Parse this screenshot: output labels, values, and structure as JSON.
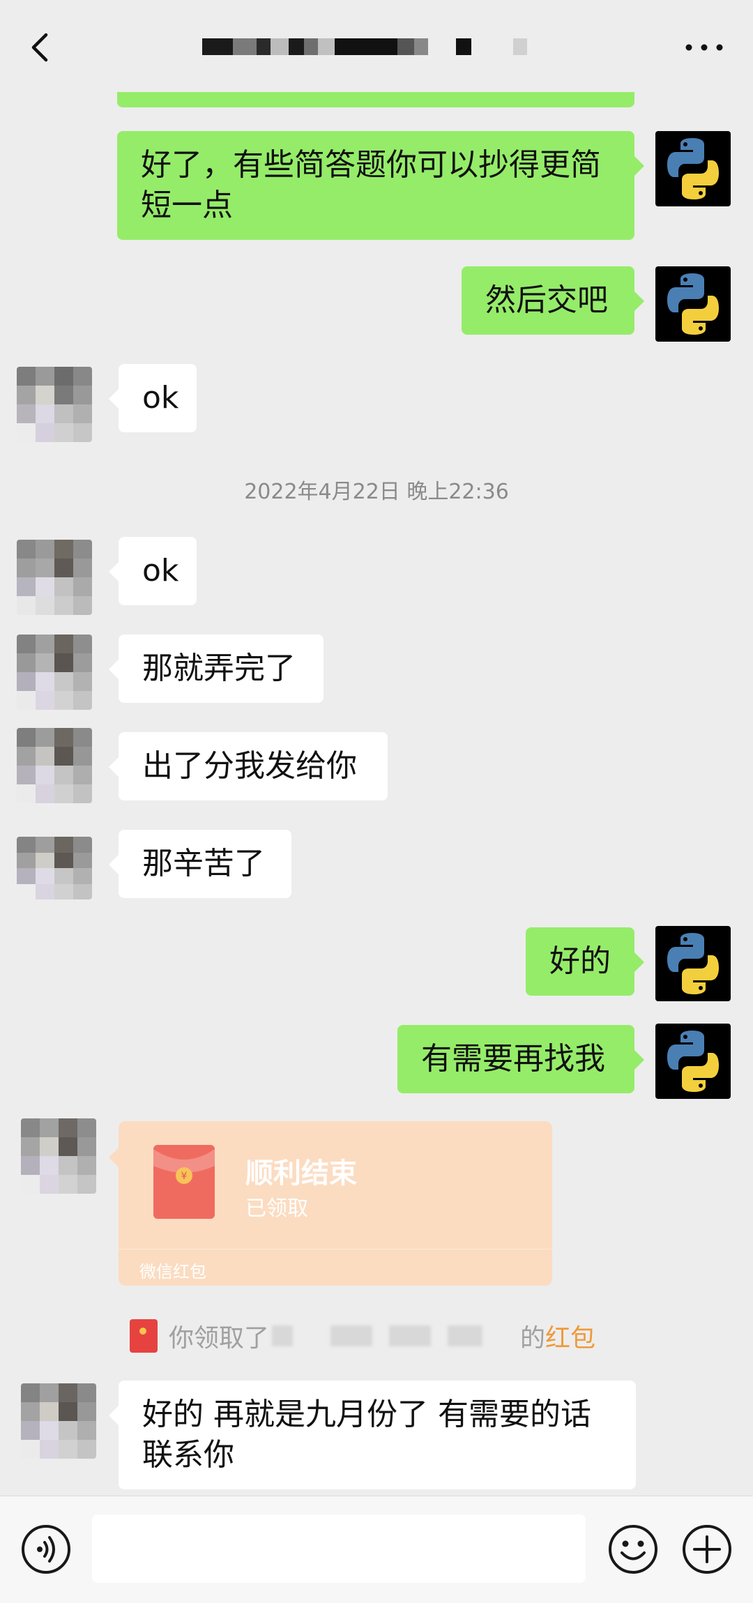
{
  "header": {
    "back_icon": "chevron-left-icon",
    "more_icon": "more-dots-icon",
    "title_redacted": true
  },
  "messages": [
    {
      "side": "right",
      "text": "好了，有些简答题你可以抄得更简短一点"
    },
    {
      "side": "right",
      "text": "然后交吧"
    },
    {
      "side": "left",
      "text": "ok"
    },
    {
      "side": "left",
      "text": "ok"
    },
    {
      "side": "left",
      "text": "那就弄完了"
    },
    {
      "side": "left",
      "text": "出了分我发给你"
    },
    {
      "side": "left",
      "text": "那辛苦了"
    },
    {
      "side": "right",
      "text": "好的"
    },
    {
      "side": "right",
      "text": "有需要再找我"
    },
    {
      "side": "left",
      "text": "好的 再就是九月份了 有需要的话联系你"
    }
  ],
  "timestamp": "2022年4月22日 晚上22:36",
  "red_packet": {
    "title": "顺利结束",
    "status": "已领取",
    "footer": "微信红包",
    "color": "#fbdcc1"
  },
  "received_note": {
    "prefix": "你领取了",
    "mid": "的",
    "link": "红包"
  },
  "colors": {
    "my_bubble": "#95ec69",
    "their_bubble": "#ffffff",
    "background": "#ededed",
    "red_link": "#ee9a39"
  },
  "bottom_bar": {
    "voice_icon": "voice-icon",
    "emoji_icon": "emoji-icon",
    "plus_icon": "plus-icon"
  }
}
